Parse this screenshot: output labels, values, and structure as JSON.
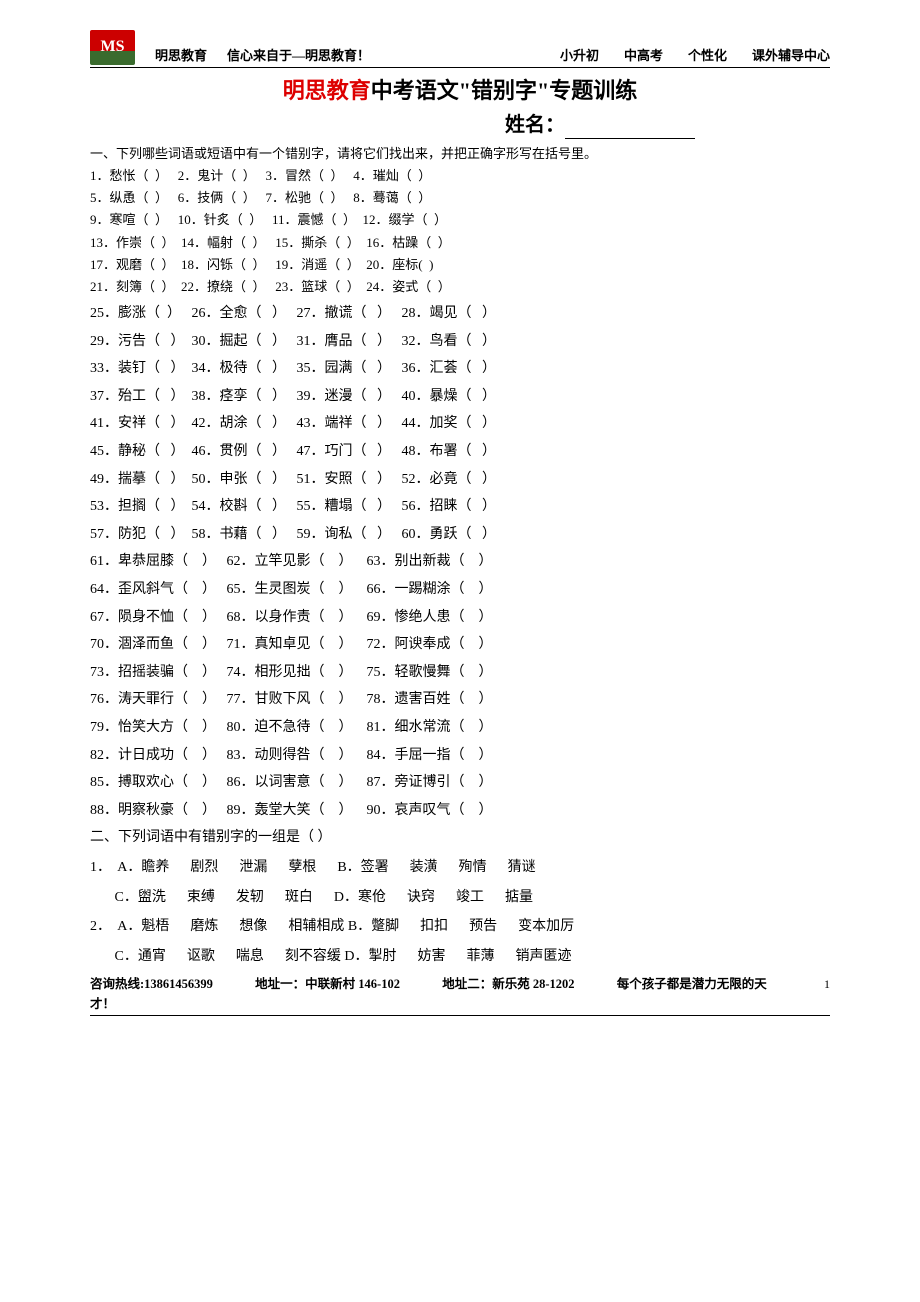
{
  "header": {
    "logo_text": "MS",
    "brand": "明思教育",
    "slogan": "信心来自于—明思教育！",
    "nav": [
      "小升初",
      "中高考",
      "个性化",
      "课外辅导中心"
    ]
  },
  "title": {
    "red": "明思教育",
    "black": "中考语文\"错别字\"专题训练"
  },
  "name_label": "姓名：",
  "section1": {
    "instruction": "一、下列哪些词语或短语中有一个错别字，请将它们找出来，并把正确字形写在括号里。",
    "block_a": [
      "1．愁怅（  ）   2．鬼计（  ）   3．冒然（  ）   4．璀灿（  ）",
      "5．纵恿（  ）   6．技俩（  ）   7．松驰（  ）   8．蓦蔼（  ）",
      "9．寒喧（  ）   10．针炙（  ）   11．震憾（  ）  12．缀学（  ）",
      "13．作崇（  ）  14．幅射（  ）   15．撕杀（  ）  16．枯躁（  ）",
      "17．观磨（  ）  18．闪铄（  ）   19．消遥（  ）  20．座标(  )",
      "21．刻簿（  ）  22．撩绕（  ）   23．篮球（  ）  24．姿式（  ）"
    ],
    "block_b": [
      "25．膨涨（  ）   26．全愈（   ）   27．撤谎（   ）   28．竭见（   ）",
      "29．污告（   ）  30．掘起（   ）   31．膺品（   ）   32．鸟看（   ）",
      "33．装钉（   ）  34．极待（   ）   35．园满（   ）   36．汇荟（   ）",
      "37．殆工（   ）  38．痉孪（   ）   39．迷漫（   ）   40．暴燥（   ）",
      "41．安祥（   ）  42．胡涂（   ）   43．端祥（   ）   44．加奖（   ）",
      "45．静秘（   ）  46．贯例（   ）   47．巧门（   ）   48．布署（   ）",
      "49．揣摹（   ）  50．申张（   ）   51．安照（   ）   52．必竟（   ）",
      "53．担搁（   ）  54．校斟（   ）   55．糟塌（   ）   56．招睐（   ）",
      "57．防犯（   ）  58．书藉（   ）   59．询私（   ）   60．勇跃（   ）"
    ],
    "block_c": [
      "61．卑恭屈膝（    ）   62．立竿见影（    ）    63．别出新裁（    ）",
      "64．歪风斜气（    ）   65．生灵图炭（    ）    66．一踢糊涂（    ）",
      "67．陨身不恤（    ）   68．以身作责（    ）    69．惨绝人患（    ）",
      "70．涸泽而鱼（    ）   71．真知卓见（    ）    72．阿谀奉成（    ）",
      "73．招摇装骗（    ）   74．相形见拙（    ）    75．轻歌慢舞（    ）",
      "76．涛天罪行（    ）   77．甘败下风（    ）    78．遗害百姓（    ）",
      "79．怡笑大方（    ）   80．迫不急待（    ）    81．细水常流（    ）",
      "82．计日成功（    ）   83．动则得咎（    ）    84．手屈一指（    ）",
      "85．搏取欢心（    ）   86．以词害意（    ）    87．旁证博引（    ）",
      "88．明察秋豪（    ）   89．轰堂大笑（    ）    90．哀声叹气（    ）"
    ]
  },
  "section2": {
    "instruction": "二、下列词语中有错别字的一组是（  ）",
    "q1a": "1．  A．瞻养      剧烈      泄漏      孽根      B．签署      装潢      殉情      猜谜",
    "q1b": "       C．盥洗      束缚      发轫      斑白      D．寒伧      诀窍      竣工      掂量",
    "q2a": "2．  A．魁梧      磨炼      想像      相辅相成 B．蹩脚      扣扣      预告      变本加厉",
    "q2b": "       C．通宵      讴歌      喘息      刻不容缓 D．掣肘      妨害      菲薄      销声匿迹"
  },
  "footer": {
    "hotline": "咨询热线:13861456399",
    "addr1": "地址一：中联新村 146-102",
    "addr2": "地址二：新乐苑 28-1202",
    "slogan_a": "每个孩子都是潜力无限的天",
    "slogan_b": "才！",
    "page": "1"
  }
}
